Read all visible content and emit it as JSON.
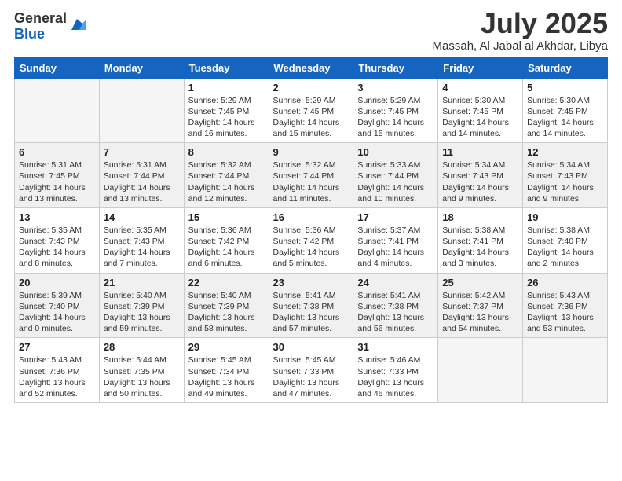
{
  "logo": {
    "general": "General",
    "blue": "Blue"
  },
  "header": {
    "month": "July 2025",
    "location": "Massah, Al Jabal al Akhdar, Libya"
  },
  "days_of_week": [
    "Sunday",
    "Monday",
    "Tuesday",
    "Wednesday",
    "Thursday",
    "Friday",
    "Saturday"
  ],
  "weeks": [
    [
      {
        "day": "",
        "detail": ""
      },
      {
        "day": "",
        "detail": ""
      },
      {
        "day": "1",
        "detail": "Sunrise: 5:29 AM\nSunset: 7:45 PM\nDaylight: 14 hours and 16 minutes."
      },
      {
        "day": "2",
        "detail": "Sunrise: 5:29 AM\nSunset: 7:45 PM\nDaylight: 14 hours and 15 minutes."
      },
      {
        "day": "3",
        "detail": "Sunrise: 5:29 AM\nSunset: 7:45 PM\nDaylight: 14 hours and 15 minutes."
      },
      {
        "day": "4",
        "detail": "Sunrise: 5:30 AM\nSunset: 7:45 PM\nDaylight: 14 hours and 14 minutes."
      },
      {
        "day": "5",
        "detail": "Sunrise: 5:30 AM\nSunset: 7:45 PM\nDaylight: 14 hours and 14 minutes."
      }
    ],
    [
      {
        "day": "6",
        "detail": "Sunrise: 5:31 AM\nSunset: 7:45 PM\nDaylight: 14 hours and 13 minutes."
      },
      {
        "day": "7",
        "detail": "Sunrise: 5:31 AM\nSunset: 7:44 PM\nDaylight: 14 hours and 13 minutes."
      },
      {
        "day": "8",
        "detail": "Sunrise: 5:32 AM\nSunset: 7:44 PM\nDaylight: 14 hours and 12 minutes."
      },
      {
        "day": "9",
        "detail": "Sunrise: 5:32 AM\nSunset: 7:44 PM\nDaylight: 14 hours and 11 minutes."
      },
      {
        "day": "10",
        "detail": "Sunrise: 5:33 AM\nSunset: 7:44 PM\nDaylight: 14 hours and 10 minutes."
      },
      {
        "day": "11",
        "detail": "Sunrise: 5:34 AM\nSunset: 7:43 PM\nDaylight: 14 hours and 9 minutes."
      },
      {
        "day": "12",
        "detail": "Sunrise: 5:34 AM\nSunset: 7:43 PM\nDaylight: 14 hours and 9 minutes."
      }
    ],
    [
      {
        "day": "13",
        "detail": "Sunrise: 5:35 AM\nSunset: 7:43 PM\nDaylight: 14 hours and 8 minutes."
      },
      {
        "day": "14",
        "detail": "Sunrise: 5:35 AM\nSunset: 7:43 PM\nDaylight: 14 hours and 7 minutes."
      },
      {
        "day": "15",
        "detail": "Sunrise: 5:36 AM\nSunset: 7:42 PM\nDaylight: 14 hours and 6 minutes."
      },
      {
        "day": "16",
        "detail": "Sunrise: 5:36 AM\nSunset: 7:42 PM\nDaylight: 14 hours and 5 minutes."
      },
      {
        "day": "17",
        "detail": "Sunrise: 5:37 AM\nSunset: 7:41 PM\nDaylight: 14 hours and 4 minutes."
      },
      {
        "day": "18",
        "detail": "Sunrise: 5:38 AM\nSunset: 7:41 PM\nDaylight: 14 hours and 3 minutes."
      },
      {
        "day": "19",
        "detail": "Sunrise: 5:38 AM\nSunset: 7:40 PM\nDaylight: 14 hours and 2 minutes."
      }
    ],
    [
      {
        "day": "20",
        "detail": "Sunrise: 5:39 AM\nSunset: 7:40 PM\nDaylight: 14 hours and 0 minutes."
      },
      {
        "day": "21",
        "detail": "Sunrise: 5:40 AM\nSunset: 7:39 PM\nDaylight: 13 hours and 59 minutes."
      },
      {
        "day": "22",
        "detail": "Sunrise: 5:40 AM\nSunset: 7:39 PM\nDaylight: 13 hours and 58 minutes."
      },
      {
        "day": "23",
        "detail": "Sunrise: 5:41 AM\nSunset: 7:38 PM\nDaylight: 13 hours and 57 minutes."
      },
      {
        "day": "24",
        "detail": "Sunrise: 5:41 AM\nSunset: 7:38 PM\nDaylight: 13 hours and 56 minutes."
      },
      {
        "day": "25",
        "detail": "Sunrise: 5:42 AM\nSunset: 7:37 PM\nDaylight: 13 hours and 54 minutes."
      },
      {
        "day": "26",
        "detail": "Sunrise: 5:43 AM\nSunset: 7:36 PM\nDaylight: 13 hours and 53 minutes."
      }
    ],
    [
      {
        "day": "27",
        "detail": "Sunrise: 5:43 AM\nSunset: 7:36 PM\nDaylight: 13 hours and 52 minutes."
      },
      {
        "day": "28",
        "detail": "Sunrise: 5:44 AM\nSunset: 7:35 PM\nDaylight: 13 hours and 50 minutes."
      },
      {
        "day": "29",
        "detail": "Sunrise: 5:45 AM\nSunset: 7:34 PM\nDaylight: 13 hours and 49 minutes."
      },
      {
        "day": "30",
        "detail": "Sunrise: 5:45 AM\nSunset: 7:33 PM\nDaylight: 13 hours and 47 minutes."
      },
      {
        "day": "31",
        "detail": "Sunrise: 5:46 AM\nSunset: 7:33 PM\nDaylight: 13 hours and 46 minutes."
      },
      {
        "day": "",
        "detail": ""
      },
      {
        "day": "",
        "detail": ""
      }
    ]
  ]
}
